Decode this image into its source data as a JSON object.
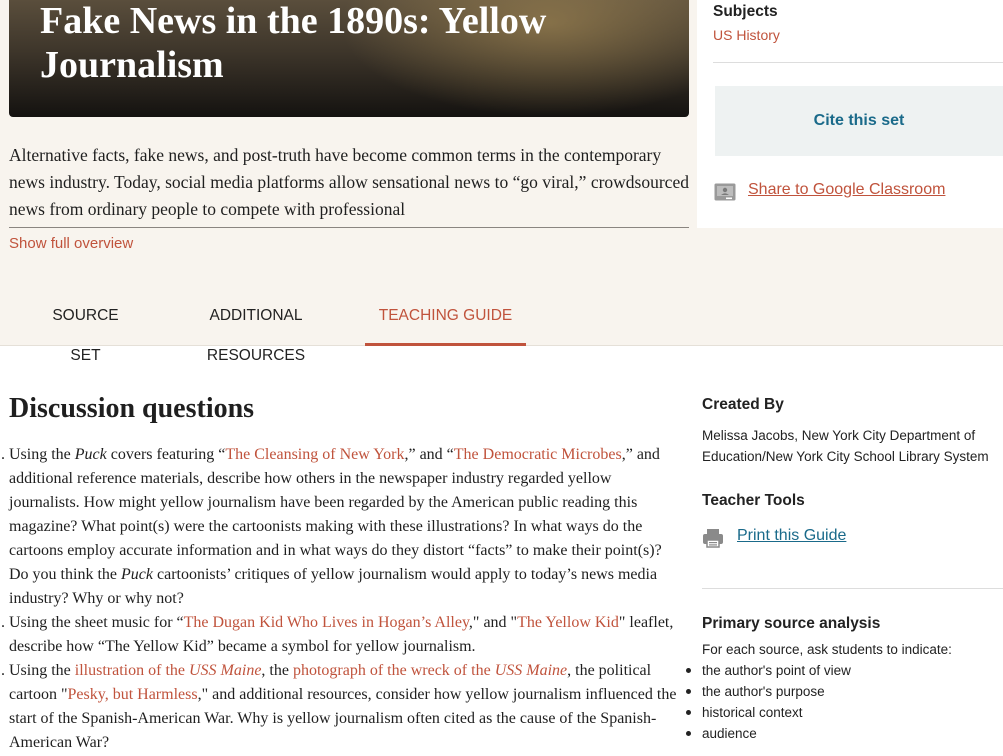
{
  "hero": {
    "title": "Fake News in the 1890s: Yellow Journalism"
  },
  "overview": {
    "text": "Alternative facts, fake news, and post-truth have become common terms in the contemporary news industry. Today, social media platforms allow sensational news to “go viral,” crowdsourced news from ordinary people to compete with professional",
    "show_full_label": "Show full overview"
  },
  "sidebar_top": {
    "subjects_heading": "Subjects",
    "subjects_value": "US History",
    "cite_label": "Cite this set",
    "classroom_label": "Share to Google Classroom"
  },
  "tabs": [
    {
      "label": "SOURCE SET",
      "active": false
    },
    {
      "label": "ADDITIONAL RESOURCES",
      "active": false
    },
    {
      "label": "TEACHING GUIDE",
      "active": true
    }
  ],
  "discussion": {
    "heading": "Discussion questions",
    "q1": {
      "p1": "Using the ",
      "i1": "Puck",
      "p2": " covers featuring “",
      "l1": "The Cleansing of New York",
      "p3": ",” and “",
      "l2": "The Democratic Microbes",
      "p4": ",” and additional reference materials, describe how others in the newspaper industry regarded yellow journalists. How might yellow journalism have been regarded by the American public reading this magazine? What point(s) were the cartoonists making with these illustrations? In what ways do the cartoons employ accurate information and in what ways do they distort “facts” to make their point(s)? Do you think the ",
      "i2": "Puck",
      "p5": " cartoonists’ critiques of yellow journalism would apply to today’s news media industry? Why or why not?"
    },
    "q2": {
      "p1": "Using the sheet music for “",
      "l1": "The Dugan Kid Who Lives in Hogan’s Alley",
      "p2": ",\" and \"",
      "l2": "The Yellow Kid",
      "p3": "\" leaflet, describe how “The Yellow Kid” became a symbol for yellow journalism."
    },
    "q3": {
      "p1": "Using the ",
      "l1a": "illustration of the ",
      "l1b": "USS Maine",
      "p2": ", the ",
      "l2a": "photograph of the wreck of the ",
      "l2b": "USS Maine",
      "p3": ", the political cartoon \"",
      "l3": "Pesky, but Harmless",
      "p4": ",\" and additional resources, consider how yellow journalism influenced the start of the Spanish-American War. Why is yellow journalism often cited as the cause of the Spanish-American War?"
    }
  },
  "sidebar": {
    "created_by_heading": "Created By",
    "created_by_text": "Melissa Jacobs, New York City Department of Education/New York City School Library System",
    "teacher_tools_heading": "Teacher Tools",
    "print_label": "Print this Guide",
    "psa_heading": "Primary source analysis",
    "psa_intro": "For each source, ask students to indicate:",
    "psa_items": [
      "the author's point of view",
      "the author's purpose",
      "historical context",
      "audience"
    ]
  },
  "colors": {
    "accent": "#c0533c",
    "link_blue": "#1a6a8a",
    "band": "#f8f4ee"
  }
}
